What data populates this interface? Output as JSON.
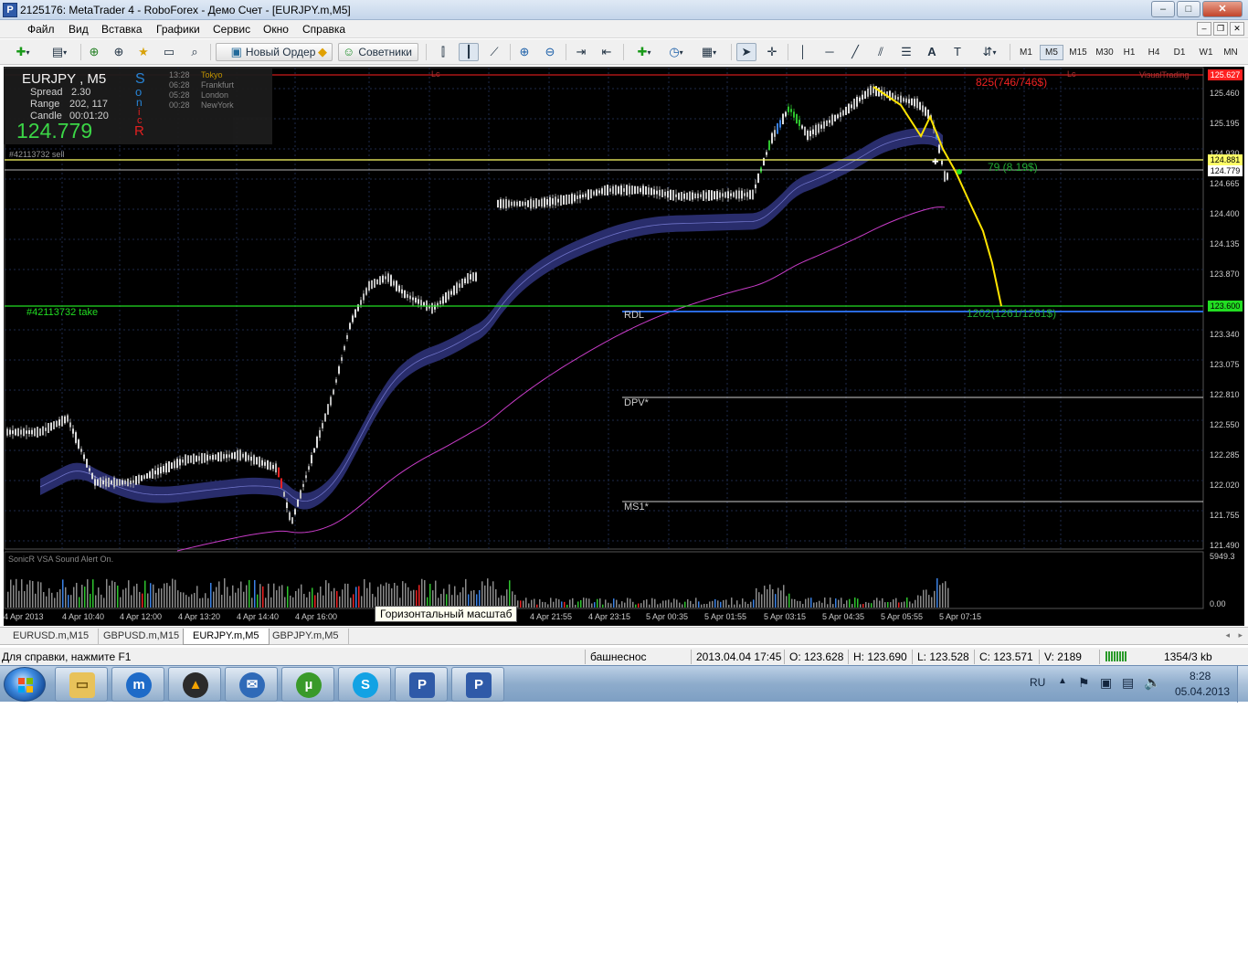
{
  "window": {
    "title": "2125176: MetaTrader 4 - RoboForex - Демо Счет - [EURJPY.m,M5]",
    "icon": "metatrader-icon",
    "controls": {
      "minimize": "–",
      "maximize": "□",
      "close": "✕"
    }
  },
  "menu": {
    "items": [
      "Файл",
      "Вид",
      "Вставка",
      "Графики",
      "Сервис",
      "Окно",
      "Справка"
    ]
  },
  "toolbar": {
    "new_order_label": "Новый Ордер",
    "advisors_label": "Советники",
    "timeframes": [
      "M1",
      "M5",
      "M15",
      "M30",
      "H1",
      "H4",
      "D1",
      "W1",
      "MN"
    ],
    "active_timeframe": "M5"
  },
  "chart": {
    "symbol_line": "EURJPY , M5",
    "spread_label": "Spread",
    "spread_value": "2.30",
    "range_label": "Range",
    "range_value": "202, 117",
    "candle_label": "Candle",
    "candle_value": "00:01:20",
    "big_price": "124.779",
    "sonic_letters": [
      "S",
      "o",
      "n",
      "i",
      "c",
      "R"
    ],
    "sessions": [
      {
        "time": "13:28",
        "name": "Tokyo"
      },
      {
        "time": "06:28",
        "name": "Frankfurt"
      },
      {
        "time": "05:28",
        "name": "London"
      },
      {
        "time": "00:28",
        "name": "NewYork"
      }
    ],
    "sell_order_label": "#42113732 sell",
    "take_label": "#42113732  take",
    "profit_top": "825(746/746$)",
    "profit_mid": "79 (8.19$)",
    "profit_bottom": "1202(1261/1261$)",
    "visual_trading": "VisualTrading",
    "lc_label": "Lc",
    "rdl_label": "RDL",
    "dpv_label": "DPV*",
    "ms1_label": "MS1*",
    "indicator_label": "SonicR VSA   Sound Alert On.",
    "price_axis": [
      "125.460",
      "125.195",
      "124.930",
      "124.665",
      "124.400",
      "124.135",
      "123.870",
      "123.340",
      "123.075",
      "122.810",
      "122.550",
      "122.285",
      "122.020",
      "121.755",
      "121.490"
    ],
    "price_tag_top": "125.627",
    "price_tag_sell": "124.881",
    "price_tag_bid": "124.779",
    "price_tag_take": "123.600",
    "volume_axis_top": "5949.3",
    "volume_axis_bottom": "0.00",
    "time_axis": [
      "4 Apr 2013",
      "4 Apr 10:40",
      "4 Apr 12:00",
      "4 Apr 13:20",
      "4 Apr 14:40",
      "4 Apr 16:00",
      "4 Apr 21:55",
      "4 Apr 23:15",
      "5 Apr 00:35",
      "5 Apr 01:55",
      "5 Apr 03:15",
      "5 Apr 04:35",
      "5 Apr 05:55",
      "5 Apr 07:15"
    ],
    "tooltip": "Горизонтальный масштаб"
  },
  "chart_tabs": [
    "EURUSD.m,M15",
    "GBPUSD.m,M15",
    "EURJPY.m,M5",
    "GBPJPY.m,M5"
  ],
  "active_chart_tab": "EURJPY.m,M5",
  "status": {
    "help": "Для справки, нажмите F1",
    "profile": "башнеснос",
    "datetime": "2013.04.04 17:45",
    "open": "O: 123.628",
    "high": "H: 123.690",
    "low": "L: 123.528",
    "close": "C: 123.571",
    "volume": "V: 2189",
    "traffic": "1354/3 kb"
  },
  "taskbar": {
    "apps": [
      "explorer-icon",
      "maxthon-icon",
      "aimp-icon",
      "thunderbird-icon",
      "utorrent-icon",
      "skype-icon",
      "metatrader-icon",
      "metatrader-icon"
    ],
    "language": "RU",
    "time": "8:28",
    "date": "05.04.2013"
  }
}
